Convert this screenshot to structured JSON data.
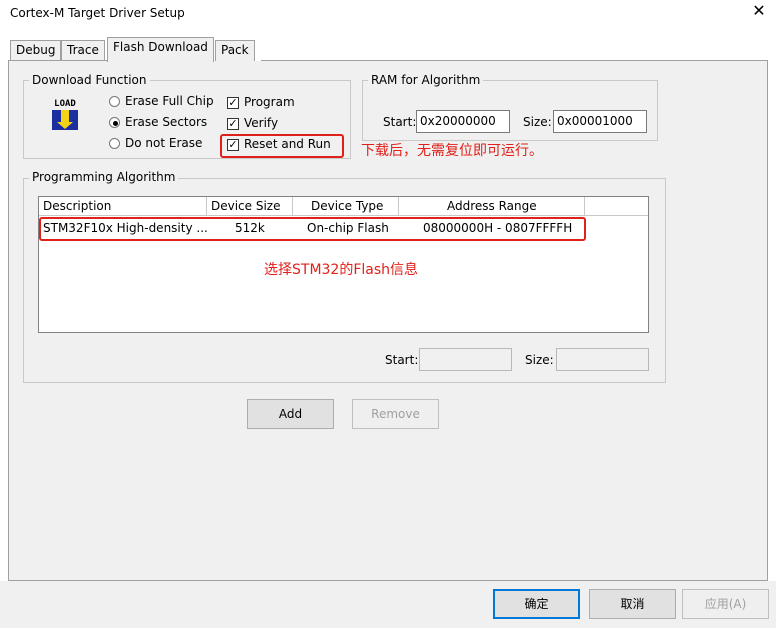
{
  "window": {
    "title": "Cortex-M Target Driver Setup",
    "close_glyph": "✕"
  },
  "tabs": [
    {
      "label": "Debug"
    },
    {
      "label": "Trace"
    },
    {
      "label": "Flash Download"
    },
    {
      "label": "Pack"
    }
  ],
  "download_function": {
    "label": "Download Function",
    "icon_text": "LOAD",
    "radios": [
      {
        "label": "Erase Full Chip",
        "checked": false
      },
      {
        "label": "Erase Sectors",
        "checked": true
      },
      {
        "label": "Do not Erase",
        "checked": false
      }
    ],
    "checks": [
      {
        "label": "Program",
        "checked": true,
        "mark": "✓"
      },
      {
        "label": "Verify",
        "checked": true,
        "mark": "✓"
      },
      {
        "label": "Reset and Run",
        "checked": true,
        "mark": "✓"
      }
    ]
  },
  "ram": {
    "label": "RAM for Algorithm",
    "start_label": "Start:",
    "start_value": "0x20000000",
    "size_label": "Size:",
    "size_value": "0x00001000"
  },
  "programming_algorithm": {
    "label": "Programming Algorithm",
    "columns": [
      "Description",
      "Device Size",
      "Device Type",
      "Address Range"
    ],
    "rows": [
      {
        "description": "STM32F10x High-density ...",
        "device_size": "512k",
        "device_type": "On-chip Flash",
        "address_range": "08000000H - 0807FFFFH"
      }
    ],
    "start_label": "Start:",
    "size_label": "Size:"
  },
  "buttons": {
    "add": "Add",
    "remove": "Remove",
    "ok": "确定",
    "cancel": "取消",
    "apply": "应用(A)"
  },
  "annotations": {
    "reset_note": "下载后，无需复位即可运行。",
    "table_note": "选择STM32的Flash信息",
    "color": "#e0201a"
  }
}
